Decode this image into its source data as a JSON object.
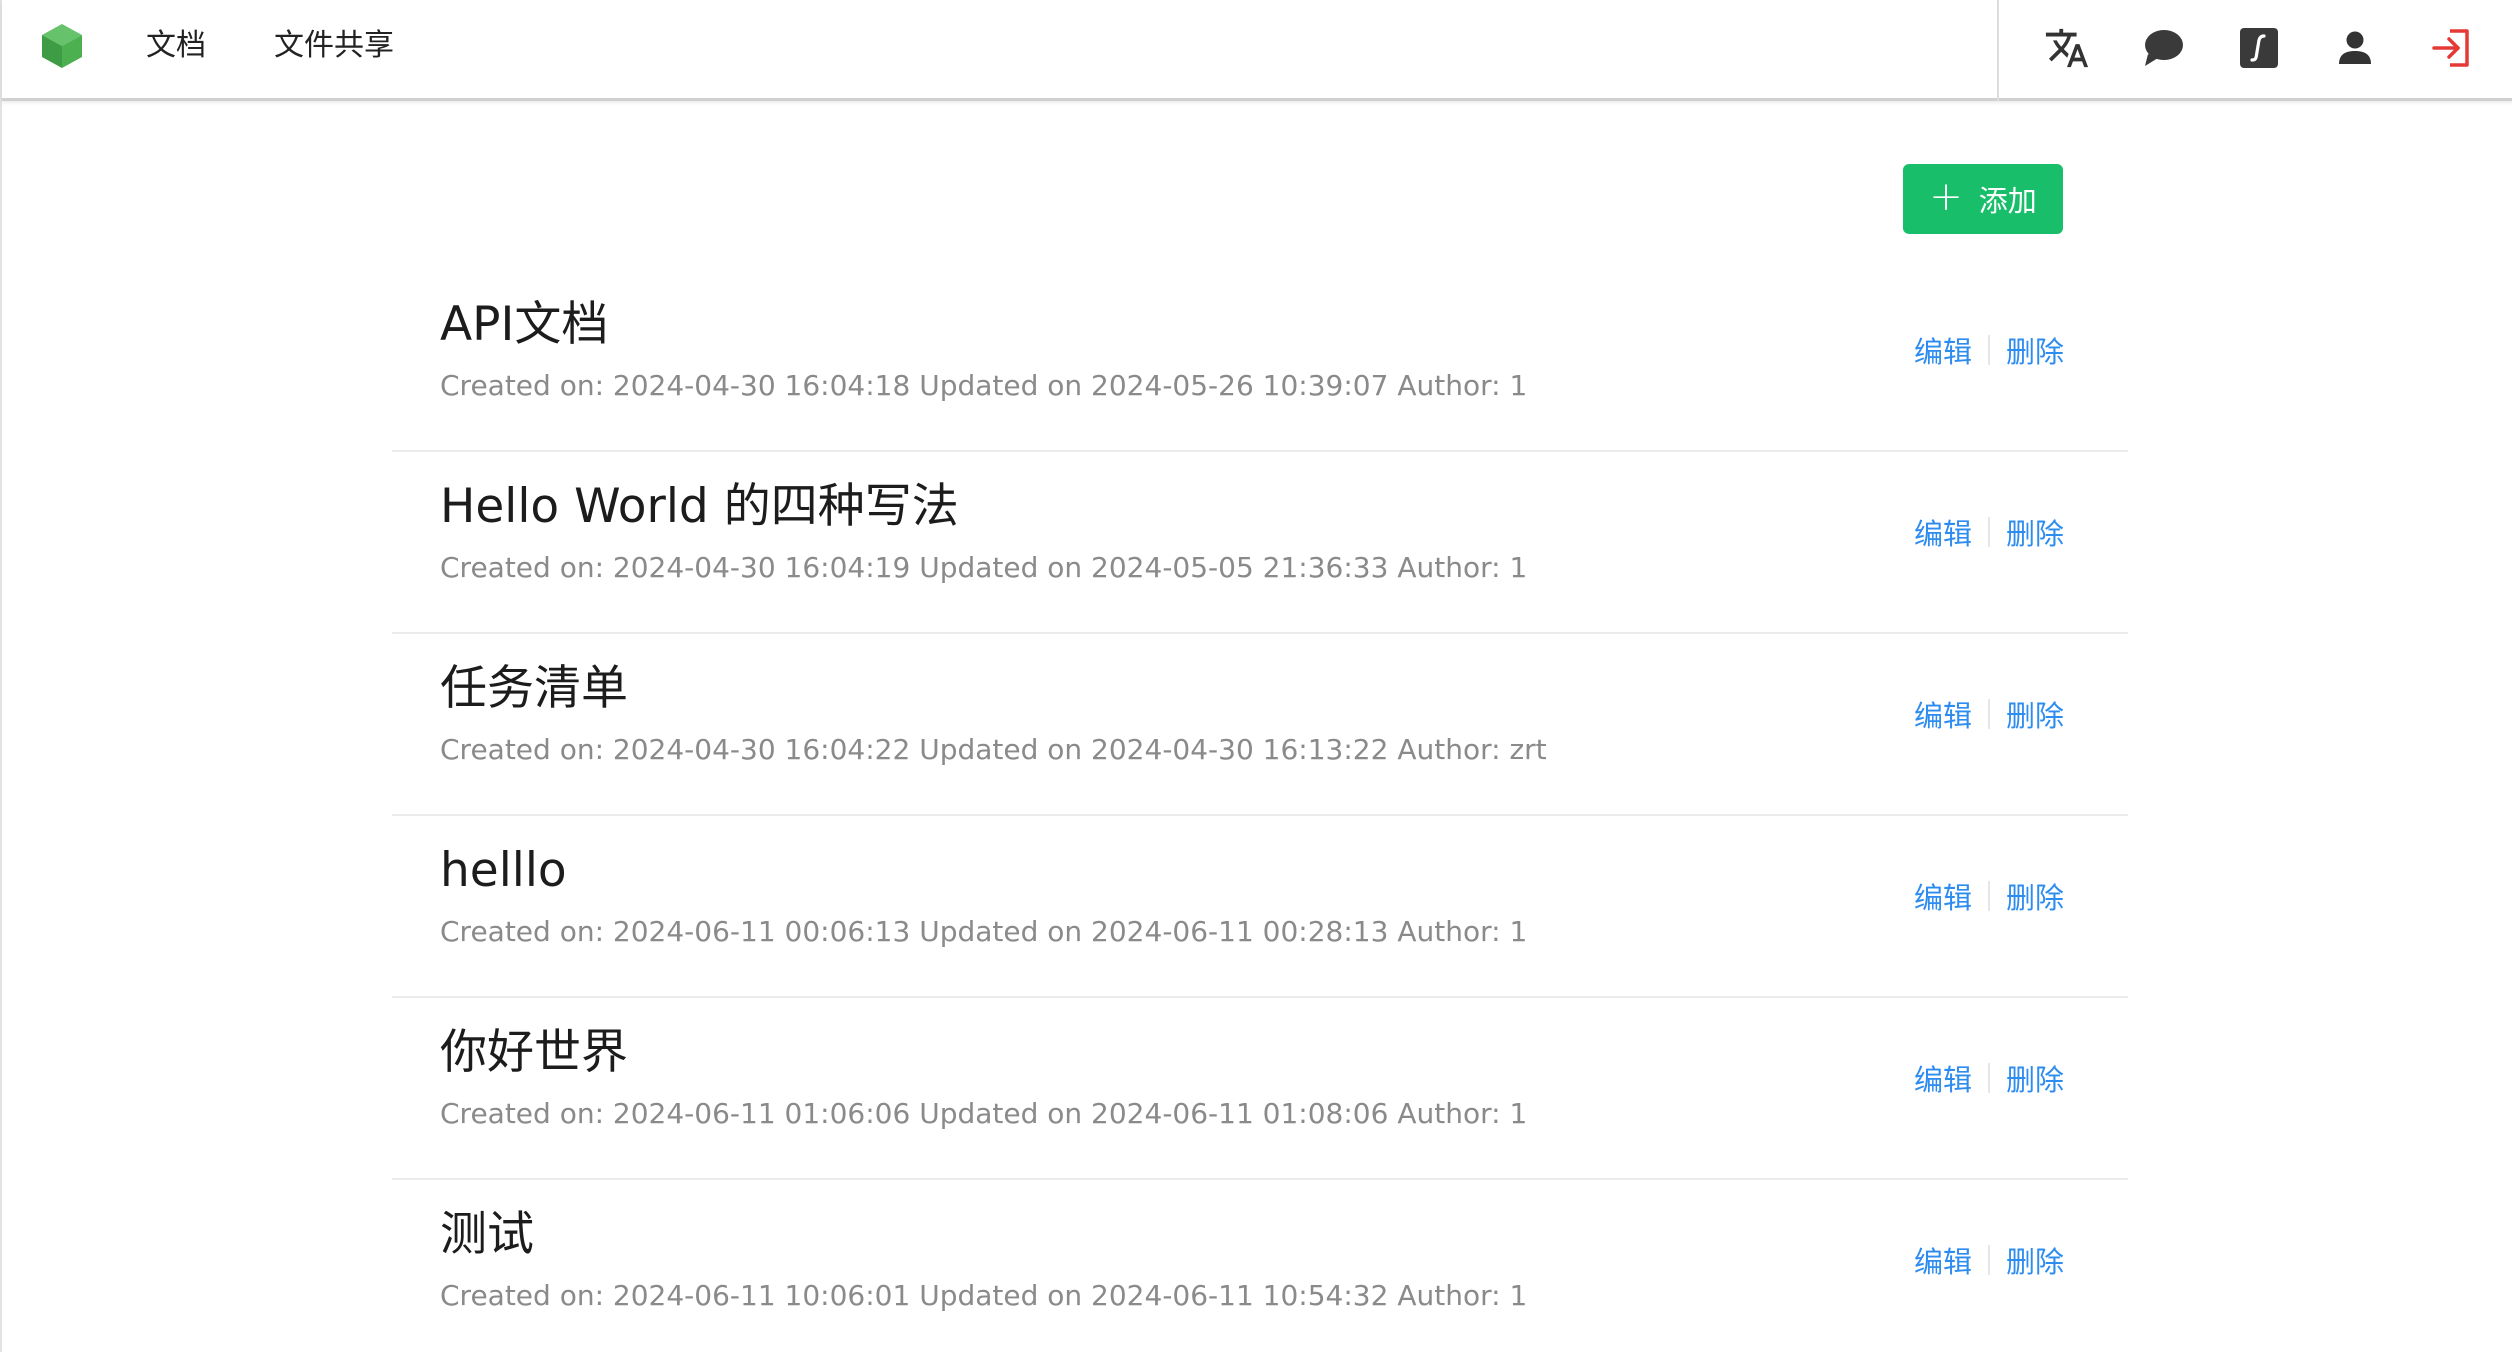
{
  "nav": {
    "docs_label": "文档",
    "share_label": "文件共享"
  },
  "toolbar": {
    "icons": [
      "translate-icon",
      "chat-icon",
      "formula-icon",
      "user-icon",
      "logout-icon"
    ]
  },
  "colors": {
    "brand_green": "#19be6b",
    "link_blue": "#2d8cf0",
    "logout_red": "#e53935",
    "logo_green": "#4caf50"
  },
  "actions": {
    "add_label": "添加",
    "edit_label": "编辑",
    "delete_label": "删除"
  },
  "documents": [
    {
      "title": "API文档",
      "meta": "Created on: 2024-04-30 16:04:18 Updated on 2024-05-26 10:39:07 Author: 1"
    },
    {
      "title": "Hello World 的四种写法",
      "meta": "Created on: 2024-04-30 16:04:19 Updated on 2024-05-05 21:36:33 Author: 1"
    },
    {
      "title": "任务清单",
      "meta": "Created on: 2024-04-30 16:04:22 Updated on 2024-04-30 16:13:22 Author: zrt"
    },
    {
      "title": "helllo",
      "meta": "Created on: 2024-06-11 00:06:13 Updated on 2024-06-11 00:28:13 Author: 1"
    },
    {
      "title": "你好世界",
      "meta": "Created on: 2024-06-11 01:06:06 Updated on 2024-06-11 01:08:06 Author: 1"
    },
    {
      "title": "测试",
      "meta": "Created on: 2024-06-11 10:06:01 Updated on 2024-06-11 10:54:32 Author: 1"
    }
  ]
}
